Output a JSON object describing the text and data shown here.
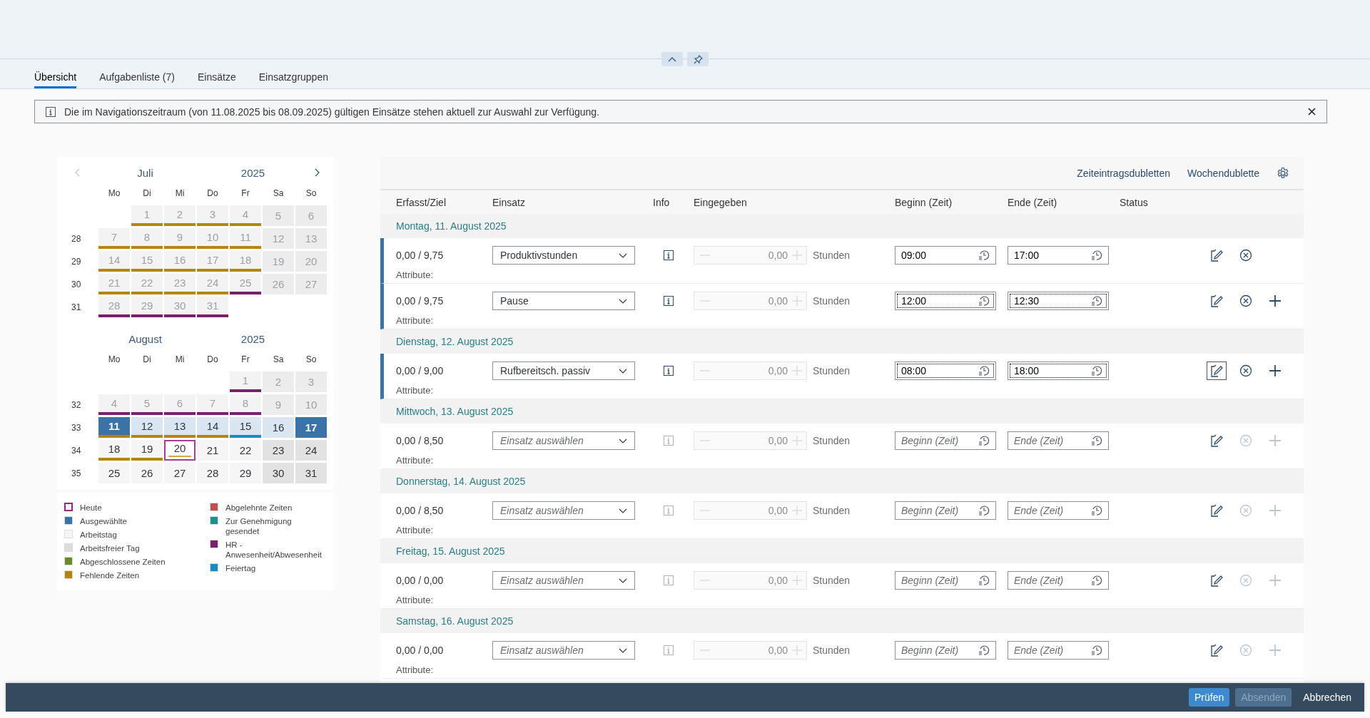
{
  "tabs": [
    {
      "label": "Übersicht",
      "selected": true
    },
    {
      "label": "Aufgabenliste (7)",
      "selected": false
    },
    {
      "label": "Einsätze",
      "selected": false
    },
    {
      "label": "Einsatzgruppen",
      "selected": false
    }
  ],
  "info_strip": {
    "text": "Die im Navigationszeitraum (von 11.08.2025 bis 08.09.2025) gültigen Einsätze stehen aktuell zur Auswahl zur Verfügung."
  },
  "calendar": {
    "months": [
      {
        "month": "Juli",
        "year": "2025",
        "weekdays": [
          "Mo",
          "Di",
          "Mi",
          "Do",
          "Fr",
          "Sa",
          "So"
        ],
        "weeks": [
          {
            "days": [
              {
                "kind": "empty"
              },
              {
                "label": "1",
                "kind": "work",
                "dimmed": true,
                "today": false,
                "color": "#b5850b"
              },
              {
                "label": "2",
                "kind": "work",
                "dimmed": true,
                "today": false,
                "color": "#b5850b"
              },
              {
                "label": "3",
                "kind": "work",
                "dimmed": true,
                "today": false,
                "color": "#b5850b"
              },
              {
                "label": "4",
                "kind": "work",
                "dimmed": true,
                "today": false,
                "color": "#b5850b"
              },
              {
                "label": "5",
                "kind": "free",
                "dimmed": true,
                "today": false
              },
              {
                "label": "6",
                "kind": "free",
                "dimmed": true,
                "today": false
              }
            ]
          },
          {
            "week": "28",
            "days": [
              {
                "label": "7",
                "kind": "work",
                "dimmed": true,
                "today": false,
                "color": "#b5850b"
              },
              {
                "label": "8",
                "kind": "work",
                "dimmed": true,
                "today": false,
                "color": "#b5850b"
              },
              {
                "label": "9",
                "kind": "work",
                "dimmed": true,
                "today": false,
                "color": "#b5850b"
              },
              {
                "label": "10",
                "kind": "work",
                "dimmed": true,
                "today": false,
                "color": "#b5850b"
              },
              {
                "label": "11",
                "kind": "work",
                "dimmed": true,
                "today": false,
                "color": "#b5850b"
              },
              {
                "label": "12",
                "kind": "free",
                "dimmed": true,
                "today": false
              },
              {
                "label": "13",
                "kind": "free",
                "dimmed": true,
                "today": false
              }
            ]
          },
          {
            "week": "29",
            "days": [
              {
                "label": "14",
                "kind": "work",
                "dimmed": true,
                "today": false,
                "color": "#b5850b"
              },
              {
                "label": "15",
                "kind": "work",
                "dimmed": true,
                "today": false,
                "color": "#b5850b"
              },
              {
                "label": "16",
                "kind": "work",
                "dimmed": true,
                "today": false,
                "color": "#b5850b"
              },
              {
                "label": "17",
                "kind": "work",
                "dimmed": true,
                "today": false,
                "color": "#b5850b"
              },
              {
                "label": "18",
                "kind": "work",
                "dimmed": true,
                "today": false,
                "color": "#b5850b"
              },
              {
                "label": "19",
                "kind": "free",
                "dimmed": true,
                "today": false
              },
              {
                "label": "20",
                "kind": "free",
                "dimmed": true,
                "today": false
              }
            ]
          },
          {
            "week": "30",
            "days": [
              {
                "label": "21",
                "kind": "work",
                "dimmed": true,
                "today": false,
                "color": "#b5850b"
              },
              {
                "label": "22",
                "kind": "work",
                "dimmed": true,
                "today": false,
                "color": "#b5850b"
              },
              {
                "label": "23",
                "kind": "work",
                "dimmed": true,
                "today": false,
                "color": "#b5850b"
              },
              {
                "label": "24",
                "kind": "work",
                "dimmed": true,
                "today": false,
                "color": "#b5850b"
              },
              {
                "label": "25",
                "kind": "work",
                "dimmed": true,
                "today": false,
                "color": "#7a1f6a"
              },
              {
                "label": "26",
                "kind": "free",
                "dimmed": true,
                "today": false
              },
              {
                "label": "27",
                "kind": "free",
                "dimmed": true,
                "today": false
              }
            ]
          },
          {
            "week": "31",
            "days": [
              {
                "label": "28",
                "kind": "work",
                "dimmed": true,
                "today": false,
                "color": "#7a1f6a"
              },
              {
                "label": "29",
                "kind": "work",
                "dimmed": true,
                "today": false,
                "color": "#7a1f6a"
              },
              {
                "label": "30",
                "kind": "work",
                "dimmed": true,
                "today": false,
                "color": "#7a1f6a"
              },
              {
                "label": "31",
                "kind": "work",
                "dimmed": true,
                "today": false,
                "color": "#7a1f6a"
              },
              {
                "kind": "empty"
              },
              {
                "kind": "empty"
              },
              {
                "kind": "empty"
              }
            ]
          }
        ]
      },
      {
        "month": "August",
        "year": "2025",
        "weekdays": [
          "Mo",
          "Di",
          "Mi",
          "Do",
          "Fr",
          "Sa",
          "So"
        ],
        "weeks": [
          {
            "days": [
              {
                "kind": "empty"
              },
              {
                "kind": "empty"
              },
              {
                "kind": "empty"
              },
              {
                "kind": "empty"
              },
              {
                "label": "1",
                "kind": "work",
                "dimmed": true,
                "today": false,
                "color": "#7a1f6a"
              },
              {
                "label": "2",
                "kind": "free",
                "dimmed": true,
                "today": false
              },
              {
                "label": "3",
                "kind": "free",
                "dimmed": true,
                "today": false
              }
            ]
          },
          {
            "week": "32",
            "days": [
              {
                "label": "4",
                "kind": "work",
                "dimmed": true,
                "today": false,
                "color": "#7a1f6a"
              },
              {
                "label": "5",
                "kind": "work",
                "dimmed": true,
                "today": false,
                "color": "#7a1f6a"
              },
              {
                "label": "6",
                "kind": "work",
                "dimmed": true,
                "today": false,
                "color": "#7a1f6a"
              },
              {
                "label": "7",
                "kind": "work",
                "dimmed": true,
                "today": false,
                "color": "#7a1f6a"
              },
              {
                "label": "8",
                "kind": "work",
                "dimmed": true,
                "today": false,
                "color": "#7a1f6a"
              },
              {
                "label": "9",
                "kind": "free",
                "dimmed": true,
                "today": false
              },
              {
                "label": "10",
                "kind": "free",
                "dimmed": true,
                "today": false
              }
            ]
          },
          {
            "week": "33",
            "days": [
              {
                "label": "11",
                "kind": "selected",
                "dimmed": false,
                "today": false,
                "color": "#b5850b"
              },
              {
                "label": "12",
                "kind": "range",
                "dimmed": false,
                "today": false,
                "color": "#b5850b"
              },
              {
                "label": "13",
                "kind": "range",
                "dimmed": false,
                "today": false,
                "color": "#b5850b"
              },
              {
                "label": "14",
                "kind": "range",
                "dimmed": false,
                "today": false,
                "color": "#b5850b"
              },
              {
                "label": "15",
                "kind": "range",
                "dimmed": false,
                "today": false,
                "color": "#168bc7"
              },
              {
                "label": "16",
                "kind": "range",
                "dimmed": false,
                "today": false
              },
              {
                "label": "17",
                "kind": "selected",
                "dimmed": false,
                "today": false
              }
            ]
          },
          {
            "week": "34",
            "days": [
              {
                "label": "18",
                "kind": "work",
                "dimmed": false,
                "today": false,
                "color": "#b5850b"
              },
              {
                "label": "19",
                "kind": "work",
                "dimmed": false,
                "today": false,
                "color": "#b5850b"
              },
              {
                "label": "20",
                "kind": "work",
                "dimmed": false,
                "today": true,
                "color": "#d9a441"
              },
              {
                "label": "21",
                "kind": "work",
                "dimmed": false,
                "today": false
              },
              {
                "label": "22",
                "kind": "work",
                "dimmed": false,
                "today": false
              },
              {
                "label": "23",
                "kind": "free",
                "dimmed": false,
                "today": false
              },
              {
                "label": "24",
                "kind": "free",
                "dimmed": false,
                "today": false
              }
            ]
          },
          {
            "week": "35",
            "days": [
              {
                "label": "25",
                "kind": "work",
                "dimmed": false,
                "today": false
              },
              {
                "label": "26",
                "kind": "work",
                "dimmed": false,
                "today": false
              },
              {
                "label": "27",
                "kind": "work",
                "dimmed": false,
                "today": false
              },
              {
                "label": "28",
                "kind": "work",
                "dimmed": false,
                "today": false
              },
              {
                "label": "29",
                "kind": "work",
                "dimmed": false,
                "today": false
              },
              {
                "label": "30",
                "kind": "free",
                "dimmed": false,
                "today": false
              },
              {
                "label": "31",
                "kind": "free",
                "dimmed": false,
                "today": false
              }
            ]
          }
        ]
      }
    ]
  },
  "legend": {
    "columns": [
      [
        {
          "label": "Heute",
          "kind": "outline",
          "color": "#8e2c8a"
        },
        {
          "label": "Ausgewählte",
          "kind": "fill",
          "color": "#3b73a8"
        },
        {
          "label": "Arbeitstag",
          "kind": "fill",
          "color": "#f5f5f5"
        },
        {
          "label": "Arbeitsfreier Tag",
          "kind": "fill",
          "color": "#dcdcdc"
        },
        {
          "label": "Abgeschlossene Zeiten",
          "kind": "fill",
          "color": "#6a8a2a"
        },
        {
          "label": "Fehlende Zeiten",
          "kind": "fill",
          "color": "#b5850b"
        }
      ],
      [
        {
          "label": "Abgelehnte Zeiten",
          "kind": "fill",
          "color": "#c94a4a"
        },
        {
          "label": "Zur Genehmigung gesendet",
          "kind": "fill",
          "color": "#1f9090"
        },
        {
          "label": "HR - Anwesenheit/Abwesenheit",
          "kind": "fill",
          "color": "#7a1f6a"
        },
        {
          "label": "Feiertag",
          "kind": "fill",
          "color": "#168bc7"
        }
      ]
    ]
  },
  "toolbar": {
    "links": [
      "Zeiteintragsdubletten",
      "Wochendublette"
    ]
  },
  "table": {
    "columns": [
      "Erfasst/Ziel",
      "Einsatz",
      "Info",
      "Eingegeben",
      "Beginn (Zeit)",
      "Ende (Zeit)",
      "Status"
    ],
    "days": [
      {
        "title": "Montag, 11. August 2025",
        "entries": [
          {
            "recorded": "0,00 / 9,75",
            "assignment": "Produktivstunden",
            "info_enabled": true,
            "quantity": "0,00",
            "unit": "Stunden",
            "begin": "09:00",
            "end": "17:00",
            "time_focused": false,
            "edit_focused": false,
            "delete_enabled": true,
            "add_shown": false,
            "marked": true,
            "attribute": "Attribute:"
          },
          {
            "recorded": "0,00 / 9,75",
            "assignment": "Pause",
            "info_enabled": true,
            "quantity": "0,00",
            "unit": "Stunden",
            "begin": "12:00",
            "end": "12:30",
            "time_focused": true,
            "edit_focused": false,
            "delete_enabled": true,
            "add_shown": true,
            "add_enabled": true,
            "marked": true,
            "attribute": "Attribute:"
          }
        ]
      },
      {
        "title": "Dienstag, 12. August 2025",
        "entries": [
          {
            "recorded": "0,00 / 9,00",
            "assignment": "Rufbereitsch. passiv",
            "info_enabled": true,
            "quantity": "0,00",
            "unit": "Stunden",
            "begin": "08:00",
            "end": "18:00",
            "time_focused": true,
            "edit_focused": true,
            "delete_enabled": true,
            "add_shown": true,
            "add_enabled": true,
            "marked": true,
            "attribute": "Attribute:"
          }
        ]
      },
      {
        "title": "Mittwoch, 13. August 2025",
        "entries": [
          {
            "recorded": "0,00 / 8,50",
            "assignment_placeholder": "Einsatz auswählen",
            "info_enabled": false,
            "quantity": "0,00",
            "unit": "Stunden",
            "begin_placeholder": "Beginn (Zeit)",
            "end_placeholder": "Ende (Zeit)",
            "time_focused": false,
            "edit_focused": false,
            "delete_enabled": false,
            "add_shown": true,
            "add_enabled": false,
            "marked": false,
            "attribute": "Attribute:"
          }
        ]
      },
      {
        "title": "Donnerstag, 14. August 2025",
        "entries": [
          {
            "recorded": "0,00 / 8,50",
            "assignment_placeholder": "Einsatz auswählen",
            "info_enabled": false,
            "quantity": "0,00",
            "unit": "Stunden",
            "begin_placeholder": "Beginn (Zeit)",
            "end_placeholder": "Ende (Zeit)",
            "time_focused": false,
            "edit_focused": false,
            "delete_enabled": false,
            "add_shown": true,
            "add_enabled": false,
            "marked": false,
            "attribute": "Attribute:"
          }
        ]
      },
      {
        "title": "Freitag, 15. August 2025",
        "entries": [
          {
            "recorded": "0,00 / 0,00",
            "assignment_placeholder": "Einsatz auswählen",
            "info_enabled": false,
            "quantity": "0,00",
            "unit": "Stunden",
            "begin_placeholder": "Beginn (Zeit)",
            "end_placeholder": "Ende (Zeit)",
            "time_focused": false,
            "edit_focused": false,
            "delete_enabled": false,
            "add_shown": true,
            "add_enabled": false,
            "marked": false,
            "attribute": "Attribute:"
          }
        ]
      },
      {
        "title": "Samstag, 16. August 2025",
        "entries": [
          {
            "recorded": "0,00 / 0,00",
            "assignment_placeholder": "Einsatz auswählen",
            "info_enabled": false,
            "quantity": "0,00",
            "unit": "Stunden",
            "begin_placeholder": "Beginn (Zeit)",
            "end_placeholder": "Ende (Zeit)",
            "time_focused": false,
            "edit_focused": false,
            "delete_enabled": false,
            "add_shown": true,
            "add_enabled": false,
            "marked": false,
            "attribute": "Attribute:"
          }
        ]
      }
    ]
  },
  "footer": {
    "buttons": [
      {
        "label": "Prüfen",
        "kind": "primary",
        "disabled": false
      },
      {
        "label": "Absenden",
        "kind": "primary",
        "disabled": true
      },
      {
        "label": "Abbrechen",
        "kind": "transparent",
        "disabled": false
      }
    ]
  }
}
